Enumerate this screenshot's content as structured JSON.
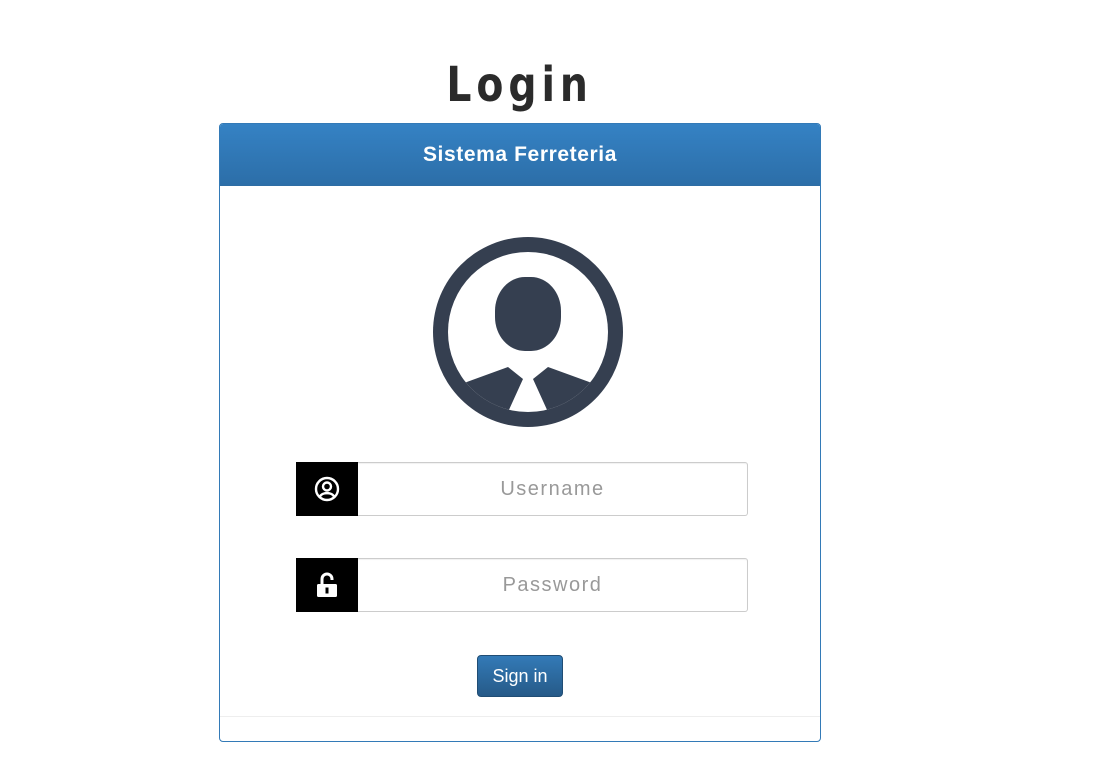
{
  "page": {
    "title": "Login"
  },
  "panel": {
    "heading": "Sistema Ferreteria"
  },
  "form": {
    "username": {
      "placeholder": "Username",
      "value": "",
      "icon": "user-circle-icon"
    },
    "password": {
      "placeholder": "Password",
      "value": "",
      "icon": "unlock-icon"
    },
    "submit_label": "Sign in"
  },
  "avatar": {
    "icon": "user-avatar-icon"
  },
  "colors": {
    "primary": "#337ab7",
    "avatar": "#353f50",
    "addon": "#000000",
    "title": "#2b2b2b"
  }
}
